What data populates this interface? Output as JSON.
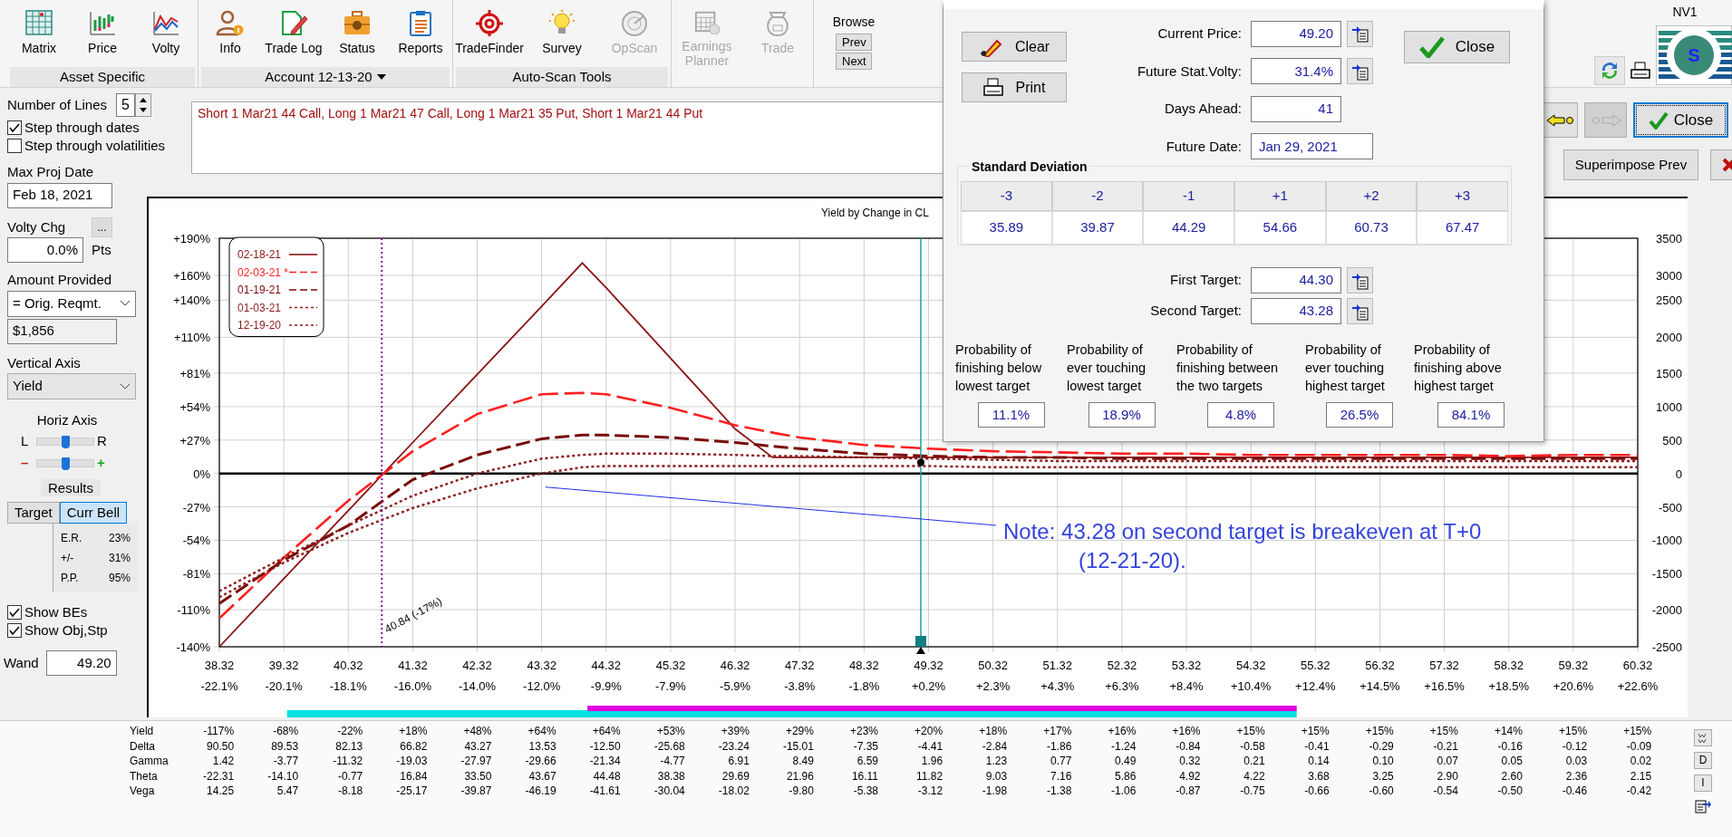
{
  "toolbar": {
    "groups": [
      {
        "label": "Asset Specific",
        "has_menu": false,
        "buttons": [
          {
            "label": "Matrix",
            "disabled": false
          },
          {
            "label": "Price",
            "disabled": false
          },
          {
            "label": "Volty",
            "disabled": false
          }
        ]
      },
      {
        "label": "Account 12-13-20",
        "has_menu": true,
        "buttons": [
          {
            "label": "Info",
            "disabled": false
          },
          {
            "label": "Trade Log",
            "disabled": false
          },
          {
            "label": "Status",
            "disabled": false
          },
          {
            "label": "Reports",
            "disabled": false
          }
        ]
      },
      {
        "label": "Auto-Scan Tools",
        "has_menu": false,
        "buttons": [
          {
            "label": "TradeFinder",
            "disabled": false
          },
          {
            "label": "Survey",
            "disabled": false
          },
          {
            "label": "OpScan",
            "disabled": true
          }
        ]
      },
      {
        "buttons": [
          {
            "label": "Earnings Planner",
            "disabled": true
          },
          {
            "label": "Trade",
            "disabled": true
          }
        ]
      }
    ],
    "browse": {
      "label": "Browse",
      "buttons": [
        "Prev",
        "Next"
      ]
    },
    "account_label": "NV1",
    "logo_letter": "S"
  },
  "left_panel": {
    "number_of_lines": {
      "label": "Number of Lines",
      "value": "5"
    },
    "step_checkboxes": [
      {
        "label": "Step through dates",
        "checked": true
      },
      {
        "label": "Step through volatilities",
        "checked": false
      }
    ],
    "max_proj_date": {
      "label": "Max Proj Date",
      "value": "Feb 18, 2021"
    },
    "volty_chg": {
      "label": "Volty Chg",
      "button": "...",
      "value": "0.0%",
      "unit": "Pts"
    },
    "amount_provided": {
      "label": "Amount Provided",
      "selection": "= Orig. Reqmt.",
      "amount": "$1,856"
    },
    "vertical_axis": {
      "label": "Vertical Axis",
      "selection": "Yield"
    },
    "horiz_axis": {
      "label": "Horiz Axis",
      "sliders": [
        {
          "left": "L",
          "right": "R",
          "level": 0.5
        },
        {
          "left": "–",
          "right": "+",
          "level": 0.5
        }
      ]
    },
    "results": {
      "label": "Results",
      "tabs": [
        {
          "label": "Target",
          "selected": false
        },
        {
          "label": "Curr Bell",
          "selected": true
        }
      ],
      "stats": [
        {
          "name": "E.R.",
          "value": "23%"
        },
        {
          "name": "+/-",
          "value": "31%"
        },
        {
          "name": "P.P.",
          "value": "95%"
        }
      ]
    },
    "show_checkboxes": [
      {
        "label": "Show BEs",
        "checked": true
      },
      {
        "label": "Show Obj,Stp",
        "checked": true
      }
    ],
    "wand": {
      "label": "Wand",
      "value": "49.20"
    }
  },
  "strategy_text": "Short 1 Mar21 44 Call, Long 1 Mar21 47 Call, Long 1 Mar21 35 Put, Short 1 Mar21 44 Put",
  "right_buttons": {
    "close": "Close",
    "superimpose": "Superimpose Prev",
    "forward_disabled": true
  },
  "chart": {
    "title": "Yield by Change in CL",
    "chart_data": {
      "type": "line",
      "x": [
        38.32,
        39.32,
        40.32,
        41.32,
        42.32,
        43.32,
        43.95,
        44.32,
        45.32,
        46.32,
        46.9,
        47.32,
        48.32,
        49.32,
        50.32,
        51.32,
        52.32,
        53.32,
        54.32,
        55.32,
        56.32,
        57.32,
        58.32,
        59.32,
        60.32
      ],
      "series": [
        {
          "name": "02-18-21",
          "color": "#8b1414",
          "line_style": "solid",
          "values": [
            -140,
            -85,
            -30,
            25,
            80,
            135,
            170,
            150,
            93,
            36,
            13,
            13,
            13,
            13,
            13,
            13,
            13,
            13,
            13,
            13,
            13,
            13,
            13,
            13,
            13
          ]
        },
        {
          "name": "02-03-21 *",
          "color": "#ff2020",
          "line_style": "long-dash",
          "values": [
            -117,
            -68,
            -22,
            18,
            48,
            64,
            65,
            64,
            53,
            39,
            33,
            29,
            23,
            20,
            18,
            17,
            16,
            16,
            15,
            15,
            15,
            15,
            14,
            15,
            15
          ]
        },
        {
          "name": "01-19-21",
          "color": "#7a0a0a",
          "line_style": "dash",
          "values": [
            -105,
            -70,
            -42,
            -5,
            15,
            28,
            31,
            31,
            29,
            25,
            22,
            20,
            16,
            14,
            13,
            13,
            12,
            12,
            12,
            12,
            12,
            12,
            12,
            12,
            12
          ]
        },
        {
          "name": "01-03-21",
          "color": "#8b1a1a",
          "line_style": "dotted",
          "values": [
            -95,
            -68,
            -42,
            -18,
            0,
            12,
            15,
            16,
            16,
            15,
            14,
            14,
            13,
            12,
            11,
            10,
            10,
            10,
            10,
            10,
            10,
            10,
            10,
            10,
            10
          ]
        },
        {
          "name": "12-19-20",
          "color": "#8b1a1b",
          "line_style": "dotted",
          "values": [
            -100,
            -72,
            -48,
            -28,
            -12,
            0,
            5,
            6,
            6,
            6,
            6,
            6,
            6,
            6,
            5,
            5,
            5,
            5,
            5,
            5,
            5,
            5,
            5,
            5,
            5
          ]
        }
      ],
      "xlim": [
        38.32,
        60.32
      ],
      "ylim": [
        -140,
        190
      ],
      "grid": true,
      "legend": true,
      "xticks": [
        {
          "value": 38.32,
          "label": "38.32"
        },
        {
          "value": 39.32,
          "label": "39.32"
        },
        {
          "value": 40.32,
          "label": "40.32"
        },
        {
          "value": 41.32,
          "label": "41.32"
        },
        {
          "value": 42.32,
          "label": "42.32"
        },
        {
          "value": 43.32,
          "label": "43.32"
        },
        {
          "value": 44.32,
          "label": "44.32"
        },
        {
          "value": 45.32,
          "label": "45.32"
        },
        {
          "value": 46.32,
          "label": "46.32"
        },
        {
          "value": 47.32,
          "label": "47.32"
        },
        {
          "value": 48.32,
          "label": "48.32"
        },
        {
          "value": 49.32,
          "label": "49.32"
        },
        {
          "value": 50.32,
          "label": "50.32"
        },
        {
          "value": 51.32,
          "label": "51.32"
        },
        {
          "value": 52.32,
          "label": "52.32"
        },
        {
          "value": 53.32,
          "label": "53.32"
        },
        {
          "value": 54.32,
          "label": "54.32"
        },
        {
          "value": 55.32,
          "label": "55.32"
        },
        {
          "value": 56.32,
          "label": "56.32"
        },
        {
          "value": 57.32,
          "label": "57.32"
        },
        {
          "value": 58.32,
          "label": "58.32"
        },
        {
          "value": 59.32,
          "label": "59.32"
        },
        {
          "value": 60.32,
          "label": "60.32"
        }
      ],
      "yticks": [
        {
          "value": 190,
          "label": "+190%"
        },
        {
          "value": 160,
          "label": "+160%"
        },
        {
          "value": 140,
          "label": "+140%"
        },
        {
          "value": 110,
          "label": "+110%"
        },
        {
          "value": 81,
          "label": "+81%"
        },
        {
          "value": 54,
          "label": "+54%"
        },
        {
          "value": 27,
          "label": "+27%"
        },
        {
          "value": 0,
          "label": "0%"
        },
        {
          "value": -27,
          "label": "-27%"
        },
        {
          "value": -54,
          "label": "-54%"
        },
        {
          "value": -81,
          "label": "-81%"
        },
        {
          "value": -110,
          "label": "-110%"
        },
        {
          "value": -140,
          "label": "-140%"
        }
      ],
      "ref_lines": [
        {
          "axis": "x",
          "value": 40.84,
          "label": "40.84 (-17%)",
          "color": "#8a10a0",
          "line_style": "dotted"
        },
        {
          "axis": "x",
          "value": 49.2,
          "color": "#20a0a0",
          "line_style": "solid"
        }
      ],
      "annotations": [
        {
          "text": "Note: 43.28 on second target is breakeven at T+0\n(12-21-20)."
        }
      ]
    },
    "x_percent_labels": [
      "-22.1%",
      "-20.1%",
      "-18.1%",
      "-16.0%",
      "-14.0%",
      "-12.0%",
      "-9.9%",
      "-7.9%",
      "-5.9%",
      "-3.8%",
      "-1.8%",
      "+0.2%",
      "+2.3%",
      "+4.3%",
      "+6.3%",
      "+8.4%",
      "+10.4%",
      "+12.4%",
      "+14.5%",
      "+16.5%",
      "+18.5%",
      "+20.6%",
      "+22.6%"
    ],
    "right_axis_labels": [
      "3500",
      "3000",
      "2500",
      "2000",
      "1500",
      "1000",
      "500",
      "0",
      "-500",
      "-1000",
      "-1500",
      "-2000",
      "-2500"
    ],
    "range_bars": [
      {
        "color": "#00e0e0"
      },
      {
        "color": "#e000e0"
      }
    ]
  },
  "greeks_table": {
    "rows": [
      {
        "label": "Yield",
        "values": [
          "-117%",
          "-68%",
          "-22%",
          "+18%",
          "+48%",
          "+64%",
          "+64%",
          "+53%",
          "+39%",
          "+29%",
          "+23%",
          "+20%",
          "+18%",
          "+17%",
          "+16%",
          "+16%",
          "+15%",
          "+15%",
          "+15%",
          "+15%",
          "+14%",
          "+15%",
          "+15%"
        ]
      },
      {
        "label": "Delta",
        "values": [
          "90.50",
          "89.53",
          "82.13",
          "66.82",
          "43.27",
          "13.53",
          "-12.50",
          "-25.68",
          "-23.24",
          "-15.01",
          "-7.35",
          "-4.41",
          "-2.84",
          "-1.86",
          "-1.24",
          "-0.84",
          "-0.58",
          "-0.41",
          "-0.29",
          "-0.21",
          "-0.16",
          "-0.12",
          "-0.09"
        ]
      },
      {
        "label": "Gamma",
        "values": [
          "1.42",
          "-3.77",
          "-11.32",
          "-19.03",
          "-27.97",
          "-29.66",
          "-21.34",
          "-4.77",
          "6.91",
          "8.49",
          "6.59",
          "1.96",
          "1.23",
          "0.77",
          "0.49",
          "0.32",
          "0.21",
          "0.14",
          "0.10",
          "0.07",
          "0.05",
          "0.03",
          "0.02"
        ]
      },
      {
        "label": "Theta",
        "values": [
          "-22.31",
          "-14.10",
          "-0.77",
          "16.84",
          "33.50",
          "43.67",
          "44.48",
          "38.38",
          "29.69",
          "21.96",
          "16.11",
          "11.82",
          "9.03",
          "7.16",
          "5.86",
          "4.92",
          "4.22",
          "3.68",
          "3.25",
          "2.90",
          "2.60",
          "2.36",
          "2.15"
        ]
      },
      {
        "label": "Vega",
        "values": [
          "14.25",
          "5.47",
          "-8.18",
          "-25.17",
          "-39.87",
          "-46.19",
          "-41.61",
          "-30.04",
          "-18.02",
          "-9.80",
          "-5.38",
          "-3.12",
          "-1.98",
          "-1.38",
          "-1.06",
          "-0.87",
          "-0.75",
          "-0.66",
          "-0.60",
          "-0.54",
          "-0.50",
          "-0.46",
          "-0.42"
        ]
      }
    ],
    "side_buttons": [
      "D",
      "I"
    ]
  },
  "target_dialog": {
    "buttons": {
      "clear": "Clear",
      "print": "Print",
      "close": "Close"
    },
    "fields": [
      {
        "label": "Current Price:",
        "value": "49.20",
        "copy_button": true
      },
      {
        "label": "Future Stat.Volty:",
        "value": "31.4%",
        "copy_button": true
      },
      {
        "label": "Days Ahead:",
        "value": "41",
        "copy_button": false
      },
      {
        "label": "Future Date:",
        "value": "Jan 29, 2021",
        "copy_button": false,
        "wide": true
      }
    ],
    "standard_deviation": {
      "title": "Standard Deviation",
      "columns": [
        "-3",
        "-2",
        "-1",
        "+1",
        "+2",
        "+3"
      ],
      "values": [
        "35.89",
        "39.87",
        "44.29",
        "54.66",
        "60.73",
        "67.47"
      ]
    },
    "targets": [
      {
        "label": "First Target:",
        "value": "44.30",
        "copy_button": true
      },
      {
        "label": "Second Target:",
        "value": "43.28",
        "copy_button": true
      }
    ],
    "probabilities": [
      {
        "label": "Probability of finishing below lowest target",
        "value": "11.1%"
      },
      {
        "label": "Probability of ever touching lowest target",
        "value": "18.9%"
      },
      {
        "label": "Probability of finishing between the two targets",
        "value": "4.8%"
      },
      {
        "label": "Probability of ever touching highest target",
        "value": "26.5%"
      },
      {
        "label": "Probability of finishing above highest target",
        "value": "84.1%"
      }
    ]
  }
}
